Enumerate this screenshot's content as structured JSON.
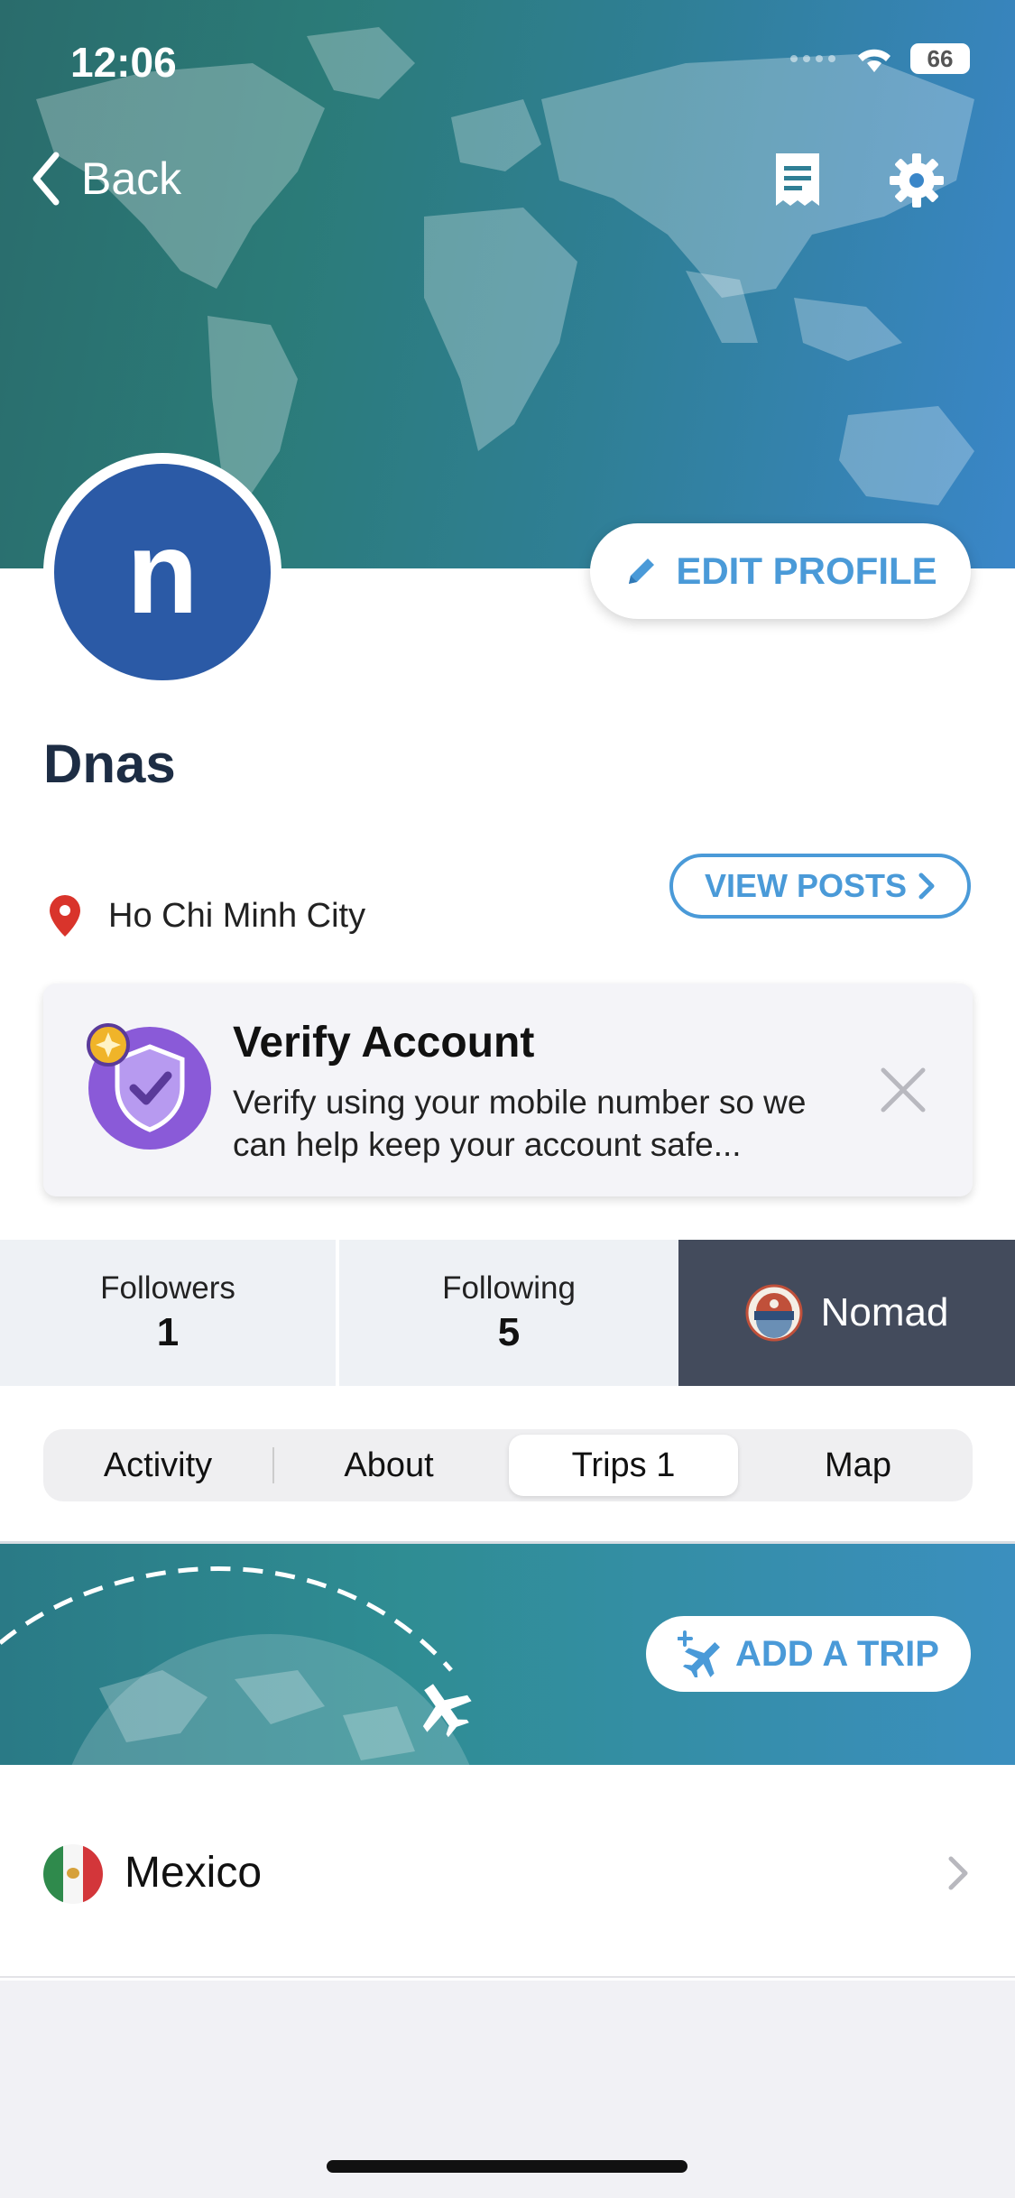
{
  "status": {
    "time": "12:06",
    "battery": "66"
  },
  "nav": {
    "back_label": "Back"
  },
  "profile": {
    "initial": "n",
    "name": "Dnas",
    "location": "Ho Chi Minh City",
    "edit_label": "EDIT PROFILE",
    "view_posts_label": "VIEW POSTS"
  },
  "verify": {
    "title": "Verify Account",
    "text": "Verify using your mobile number so we can help keep your account safe..."
  },
  "stats": {
    "followers_label": "Followers",
    "followers": "1",
    "following_label": "Following",
    "following": "5",
    "badge": "Nomad"
  },
  "tabs": [
    {
      "label": "Activity"
    },
    {
      "label": "About"
    },
    {
      "label": "Trips 1"
    },
    {
      "label": "Map"
    }
  ],
  "trips": {
    "add_label": "ADD A TRIP",
    "items": [
      {
        "country": "Mexico"
      }
    ]
  },
  "colors": {
    "accent": "#4a9ad8",
    "avatar": "#2b5aa6",
    "nomad_bg": "#434b5c",
    "pin": "#d9342b"
  }
}
